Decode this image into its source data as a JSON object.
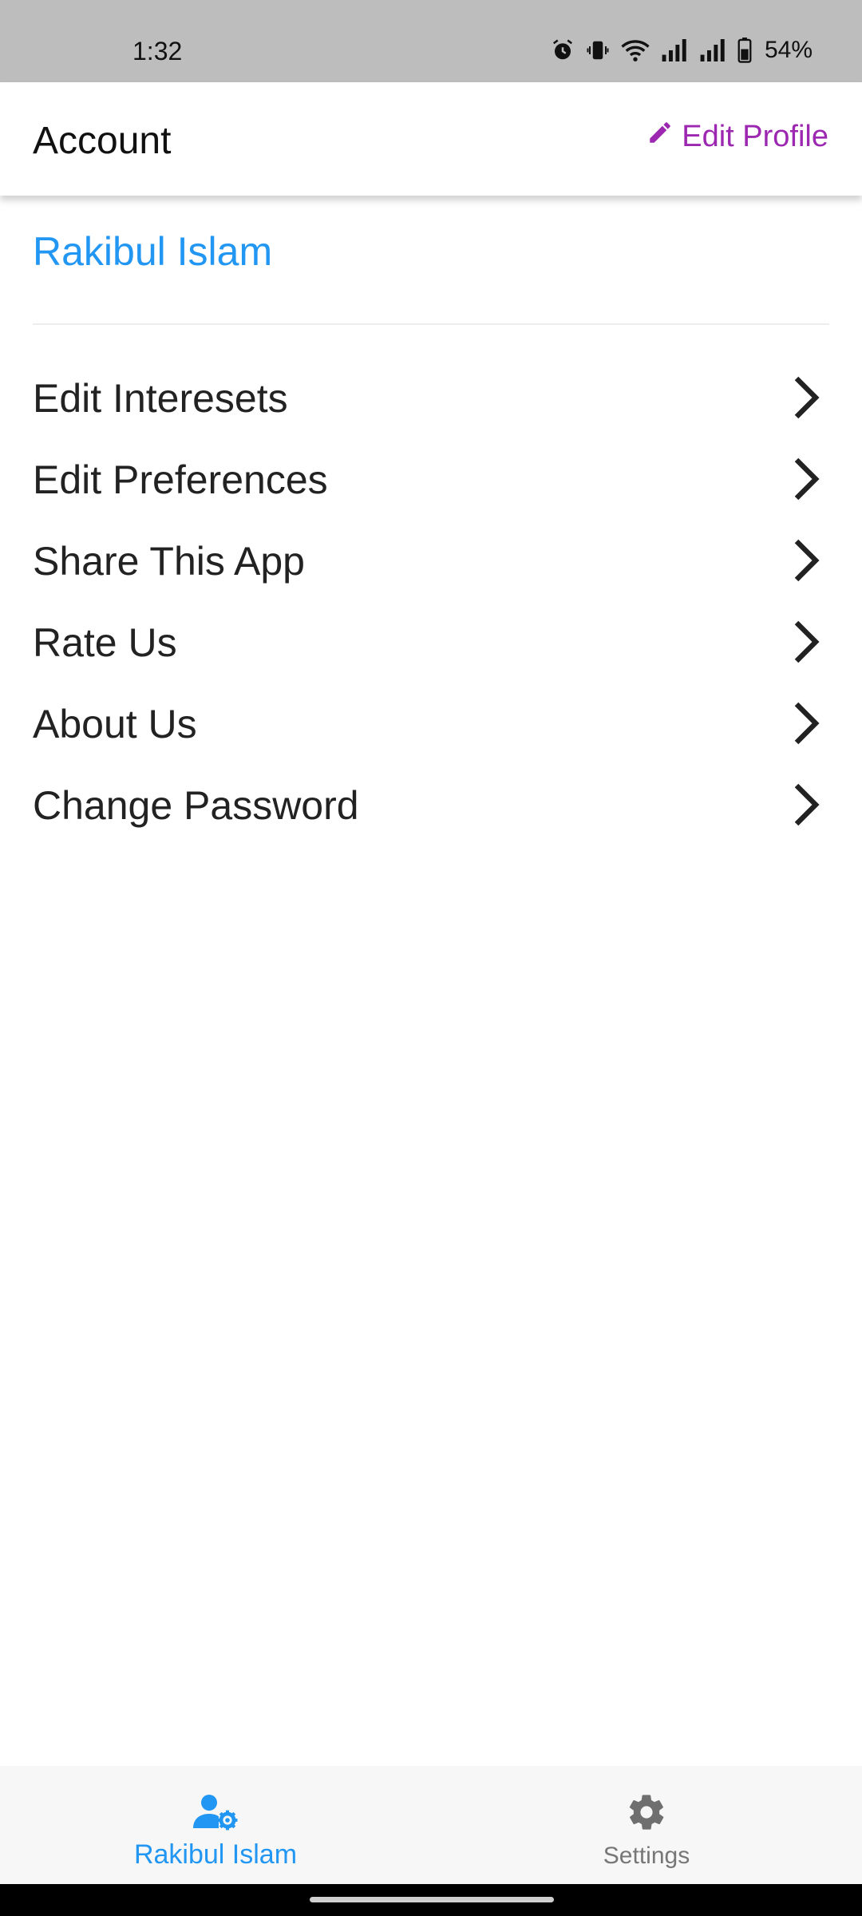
{
  "status_bar": {
    "time": "1:32",
    "battery": "54%",
    "icons": [
      "alarm-icon",
      "vibrate-icon",
      "wifi-icon",
      "signal-icon",
      "signal-icon",
      "battery-icon"
    ]
  },
  "app_bar": {
    "title": "Account",
    "edit_profile_label": "Edit Profile",
    "edit_icon": "pencil-icon",
    "accent_color": "#9c27b0"
  },
  "profile": {
    "name": "Rakibul Islam",
    "name_color": "#2196f3"
  },
  "menu": {
    "items": [
      {
        "label": "Edit Interesets"
      },
      {
        "label": "Edit Preferences"
      },
      {
        "label": "Share This App"
      },
      {
        "label": "Rate Us"
      },
      {
        "label": "About Us"
      },
      {
        "label": "Change Password"
      }
    ],
    "chevron_icon": "chevron-right-icon"
  },
  "bottom_nav": {
    "tabs": [
      {
        "label": "Rakibul Islam",
        "icon": "account-settings-icon",
        "active": true
      },
      {
        "label": "Settings",
        "icon": "gear-icon",
        "active": false
      }
    ],
    "active_color": "#2196f3",
    "inactive_color": "#777777"
  }
}
